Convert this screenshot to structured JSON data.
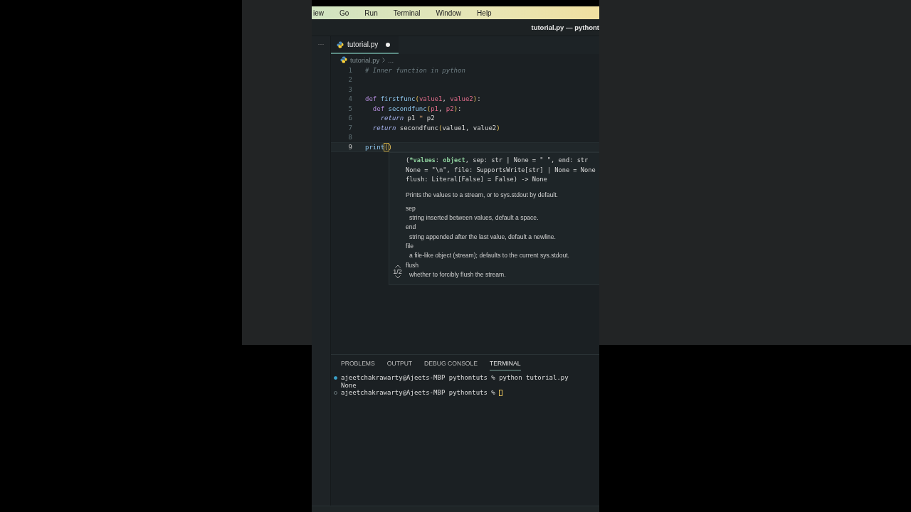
{
  "menu": [
    "iew",
    "Go",
    "Run",
    "Terminal",
    "Window",
    "Help"
  ],
  "window_title": "tutorial.py — pythont",
  "sidebar": {
    "more": "···"
  },
  "tabs": [
    {
      "label": "tutorial.py",
      "modified": true,
      "selected": true
    }
  ],
  "breadcrumb": [
    "tutorial.py",
    "..."
  ],
  "code": [
    {
      "number": "1",
      "current": false,
      "tokens": [
        {
          "text": "# Inner function in python",
          "kind": "comment"
        }
      ]
    },
    {
      "number": "2",
      "current": false
    },
    {
      "number": "3",
      "current": false
    },
    {
      "number": "4",
      "current": false,
      "tokens": [
        {
          "text": "def ",
          "kind": "keyword"
        },
        {
          "text": "firstfunc",
          "kind": "function"
        },
        {
          "text": "(",
          "kind": "bracket"
        },
        {
          "text": "value1",
          "kind": "param"
        },
        {
          "text": ", ",
          "kind": "plain"
        },
        {
          "text": "value2",
          "kind": "param"
        },
        {
          "text": ")",
          "kind": "bracket"
        },
        {
          "text": ":",
          "kind": "plain"
        }
      ]
    },
    {
      "number": "5",
      "current": false,
      "tokens": [
        {
          "text": "  def ",
          "kind": "keyword"
        },
        {
          "text": "secondfunc",
          "kind": "function"
        },
        {
          "text": "(",
          "kind": "bracket"
        },
        {
          "text": "p1",
          "kind": "param"
        },
        {
          "text": ", ",
          "kind": "plain"
        },
        {
          "text": "p2",
          "kind": "param"
        },
        {
          "text": ")",
          "kind": "bracket"
        },
        {
          "text": ":",
          "kind": "plain"
        }
      ]
    },
    {
      "number": "6",
      "current": false,
      "tokens": [
        {
          "text": "    return",
          "kind": "control"
        },
        {
          "text": " p1 ",
          "kind": "plain"
        },
        {
          "text": "*",
          "kind": "operator"
        },
        {
          "text": " p2",
          "kind": "plain"
        }
      ]
    },
    {
      "number": "7",
      "current": false,
      "tokens": [
        {
          "text": "  return",
          "kind": "control"
        },
        {
          "text": " secondfunc",
          "kind": "plain"
        },
        {
          "text": "(",
          "kind": "bracket"
        },
        {
          "text": "value1, value2",
          "kind": "plain"
        },
        {
          "text": ")",
          "kind": "bracket"
        }
      ]
    },
    {
      "number": "8",
      "current": false
    },
    {
      "number": "9",
      "current": true,
      "tokens": [
        {
          "text": "print",
          "kind": "function"
        },
        {
          "text": "(",
          "kind": "match"
        },
        {
          "text": ")",
          "kind": "bracket"
        }
      ]
    }
  ],
  "hover": {
    "signature": [
      [
        {
          "text": "(",
          "kind": "plain"
        },
        {
          "text": "*values",
          "kind": "strong"
        },
        {
          "text": ": ",
          "kind": "plain"
        },
        {
          "text": "object",
          "kind": "strong"
        },
        {
          "text": ", sep: str | None = \" \", end: str",
          "kind": "plain"
        }
      ],
      [
        {
          "text": "None = \"\\n\", file: SupportsWrite[str] | None = None",
          "kind": "plain"
        }
      ],
      [
        {
          "text": "flush: Literal[False] = False) -> None",
          "kind": "plain"
        }
      ]
    ],
    "description": "Prints the values to a stream, or to sys.stdout by default.",
    "params": [
      {
        "name": "sep",
        "doc": "string inserted between values, default a space."
      },
      {
        "name": "end",
        "doc": "string appended after the last value, default a newline."
      },
      {
        "name": "file",
        "doc": "a file-like object (stream); defaults to the current sys.stdout."
      },
      {
        "name": "flush",
        "doc": "whether to forcibly flush the stream."
      }
    ],
    "page": "1/2"
  },
  "panel_tabs": [
    {
      "label": "PROBLEMS",
      "selected": false
    },
    {
      "label": "OUTPUT",
      "selected": false
    },
    {
      "label": "DEBUG CONSOLE",
      "selected": false
    },
    {
      "label": "TERMINAL",
      "selected": true
    }
  ],
  "terminal": [
    {
      "kind": "prompt",
      "done": true,
      "text": "ajeetchakrawarty@Ajeets-MBP pythontuts % python tutorial.py",
      "cursor": false
    },
    {
      "kind": "output",
      "text": "None"
    },
    {
      "kind": "prompt",
      "done": false,
      "text": "ajeetchakrawarty@Ajeets-MBP pythontuts % ",
      "cursor": true
    }
  ]
}
